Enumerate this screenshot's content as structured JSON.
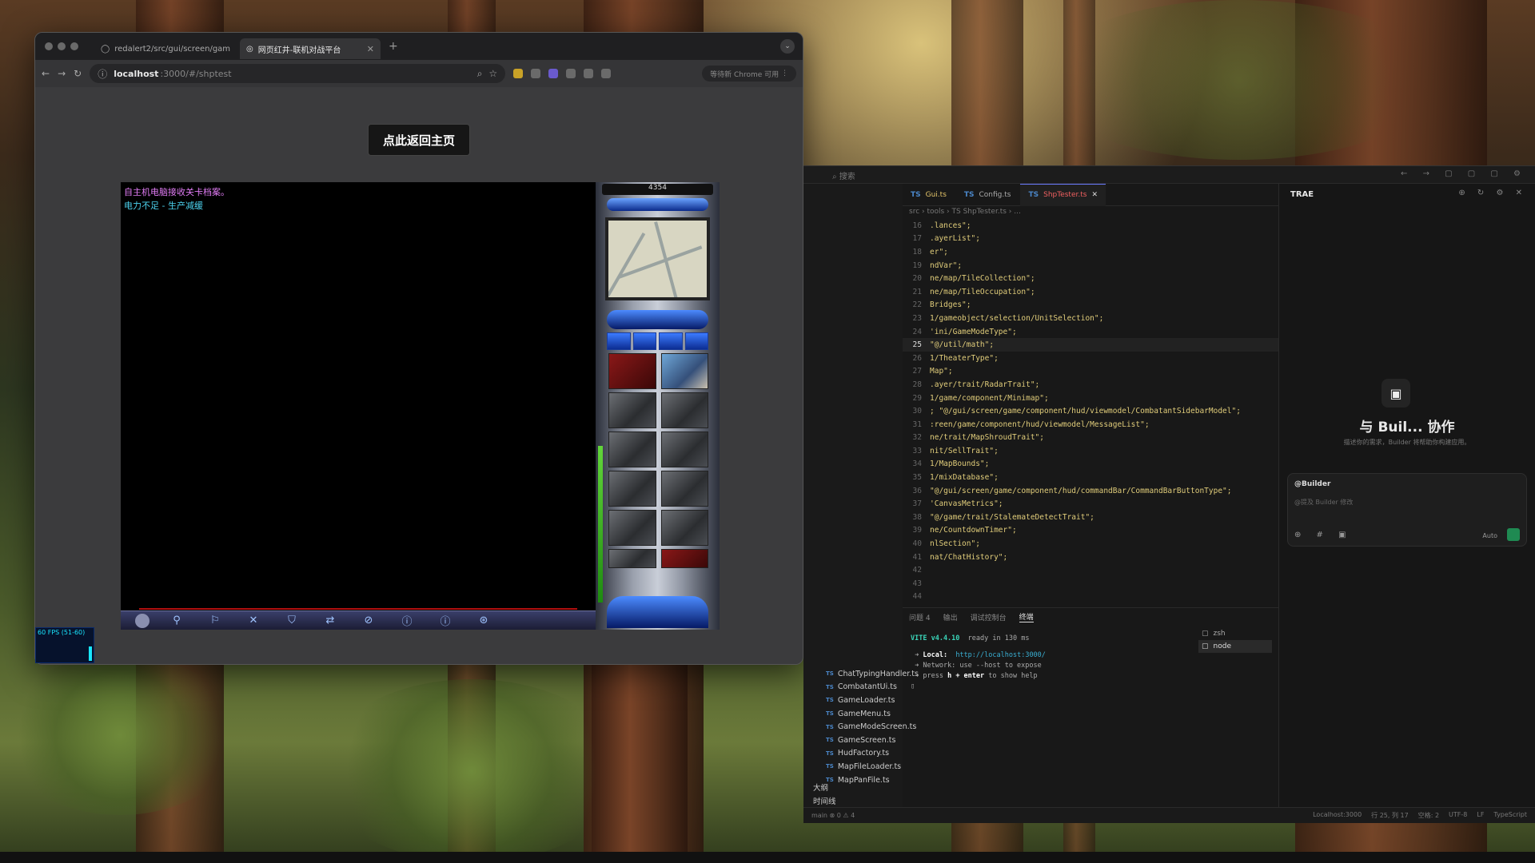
{
  "browser": {
    "tabs": [
      {
        "label": "redalert2/src/gui/screen/gam",
        "active": false
      },
      {
        "label": "网页红井-联机对战平台",
        "active": true
      }
    ],
    "url_host": "localhost",
    "url_path": ":3000/#/shptest",
    "profile_label": "等待新 Chrome 可用"
  },
  "page": {
    "home_button": "点此返回主页",
    "messages": [
      "自主机电脑接收关卡档案。",
      "电力不足 - 生产减缓"
    ],
    "credits": "4354",
    "fps": "60 FPS (51-60)",
    "command_icons": [
      "⚲",
      "⚐",
      "✕",
      "⛉",
      "⇄",
      "⊘",
      "ⓘ",
      "ⓘ",
      "⊛"
    ]
  },
  "ide": {
    "search_label": "搜索",
    "editor_tabs": [
      {
        "label": "Gui.ts",
        "state": "dirty"
      },
      {
        "label": "Config.ts",
        "state": "normal"
      },
      {
        "label": "ShpTester.ts",
        "state": "active"
      }
    ],
    "breadcrumbs": "src › tools › TS ShpTester.ts › ...",
    "code_lines": [
      {
        "n": "16",
        "t": ".lances\";"
      },
      {
        "n": "17",
        "t": ".ayerList\";"
      },
      {
        "n": "18",
        "t": "er\";"
      },
      {
        "n": "19",
        "t": "ndVar\";"
      },
      {
        "n": "20",
        "t": "ne/map/TileCollection\";"
      },
      {
        "n": "21",
        "t": "ne/map/TileOccupation\";"
      },
      {
        "n": "22",
        "t": "Bridges\";"
      },
      {
        "n": "23",
        "t": "1/gameobject/selection/UnitSelection\";"
      },
      {
        "n": "24",
        "t": "'ini/GameModeType\";"
      },
      {
        "n": "25",
        "t": "\"@/util/math\";"
      },
      {
        "n": "26",
        "t": "1/TheaterType\";"
      },
      {
        "n": "27",
        "t": "Map\";"
      },
      {
        "n": "28",
        "t": ".ayer/trait/RadarTrait\";"
      },
      {
        "n": "29",
        "t": "1/game/component/Minimap\";"
      },
      {
        "n": "30",
        "t": "; \"@/gui/screen/game/component/hud/viewmodel/CombatantSidebarModel\";"
      },
      {
        "n": "31",
        "t": ":reen/game/component/hud/viewmodel/MessageList\";"
      },
      {
        "n": "32",
        "t": "ne/trait/MapShroudTrait\";"
      },
      {
        "n": "33",
        "t": "nit/SellTrait\";"
      },
      {
        "n": "34",
        "t": "1/MapBounds\";"
      },
      {
        "n": "35",
        "t": "1/mixDatabase\";"
      },
      {
        "n": "36",
        "t": " \"@/gui/screen/game/component/hud/commandBar/CommandBarButtonType\";"
      },
      {
        "n": "37",
        "t": "'CanvasMetrics\";"
      },
      {
        "n": "38",
        "t": " \"@/game/trait/StalemateDetectTrait\";"
      },
      {
        "n": "39",
        "t": "ne/CountdownTimer\";"
      },
      {
        "n": "40",
        "t": "nlSection\";"
      },
      {
        "n": "41",
        "t": "nat/ChatHistory\";"
      },
      {
        "n": "42",
        "t": ""
      },
      {
        "n": "43",
        "t": ""
      },
      {
        "n": "44",
        "t": ""
      }
    ],
    "panel_tabs": [
      "问题 4",
      "输出",
      "调试控制台",
      "终端"
    ],
    "terminal": {
      "vite": "VITE v4.4.10",
      "ready": "ready in 130 ms",
      "local_label": "Local:",
      "local_url": "http://localhost:3000/",
      "network": "Network: use --host to expose",
      "help_prefix": "press",
      "help_key": "h + enter",
      "help_suffix": "to show help"
    },
    "terminal_list": [
      "zsh",
      "node"
    ],
    "files": [
      "ChatTypingHandler.ts",
      "CombatantUi.ts",
      "GameLoader.ts",
      "GameMenu.ts",
      "GameModeScreen.ts",
      "GameScreen.ts",
      "HudFactory.ts",
      "MapFileLoader.ts",
      "MapPanFile.ts"
    ],
    "outline": [
      "大纲",
      "时间线"
    ],
    "trae": {
      "title": "TRAE",
      "heading": "与 Buil... 协作",
      "sub": "描述你的需求，Builder 将帮助你构建应用。",
      "agent": "@Builder",
      "placeholder": "@提及 Builder 修改",
      "auto": "Auto"
    },
    "status_left": "main  ⊗ 0 ⚠ 4",
    "status_right": [
      "Localhost:3000",
      "行 25, 列 17",
      "空格: 2",
      "UTF-8",
      "LF",
      "TypeScript"
    ]
  }
}
